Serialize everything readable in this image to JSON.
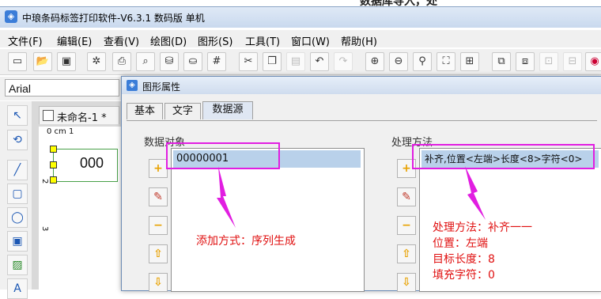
{
  "backdrop_text": "数据库导入，处",
  "window": {
    "title": "中琅条码标签打印软件-V6.3.1 数码版 单机",
    "icon": "app-logo-icon"
  },
  "menu": [
    "文件(F)",
    "编辑(E)",
    "查看(V)",
    "绘图(D)",
    "图形(S)",
    "工具(T)",
    "窗口(W)",
    "帮助(H)"
  ],
  "font": {
    "name": "Arial"
  },
  "document": {
    "tab_label": "未命名-1 *",
    "canvas_text": "000",
    "ruler_top_text": "0 cm 1",
    "ruler_left_top": "2",
    "ruler_left_bottom": "3"
  },
  "dialog": {
    "title": "图形属性",
    "tabs": [
      "基本",
      "文字",
      "数据源"
    ],
    "active_tab": "数据源",
    "data_object_label": "数据对象",
    "data_object_value": "00000001",
    "process_label": "处理方法",
    "process_value": "补齐,位置<左端>长度<8>字符<0>"
  },
  "annotations": {
    "left": "添加方式：序列生成",
    "right": [
      "处理方法：补齐一一",
      "位置：左端",
      "目标长度：8",
      "填充字符：0"
    ],
    "color": "#e01010",
    "highlight_color": "#e11ee1"
  }
}
